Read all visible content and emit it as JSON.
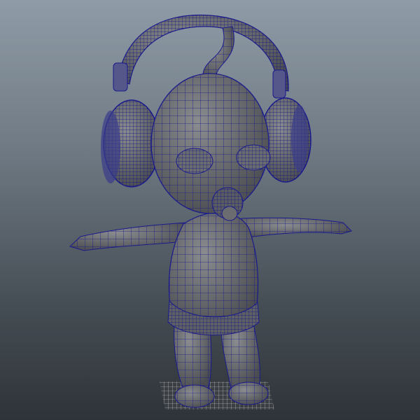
{
  "viewport": {
    "background_top": "#8f9ba6",
    "background_bottom": "#2e3338"
  },
  "model": {
    "shade_color": "#6d6f73",
    "shade_dark": "#4a4c50",
    "wire_color": "#1a1a8c",
    "wire_dense_color": "#10108a",
    "grid_color": "#d8d8d8",
    "icons": [
      "headphones-icon",
      "pacifier-icon",
      "antenna-icon"
    ]
  }
}
